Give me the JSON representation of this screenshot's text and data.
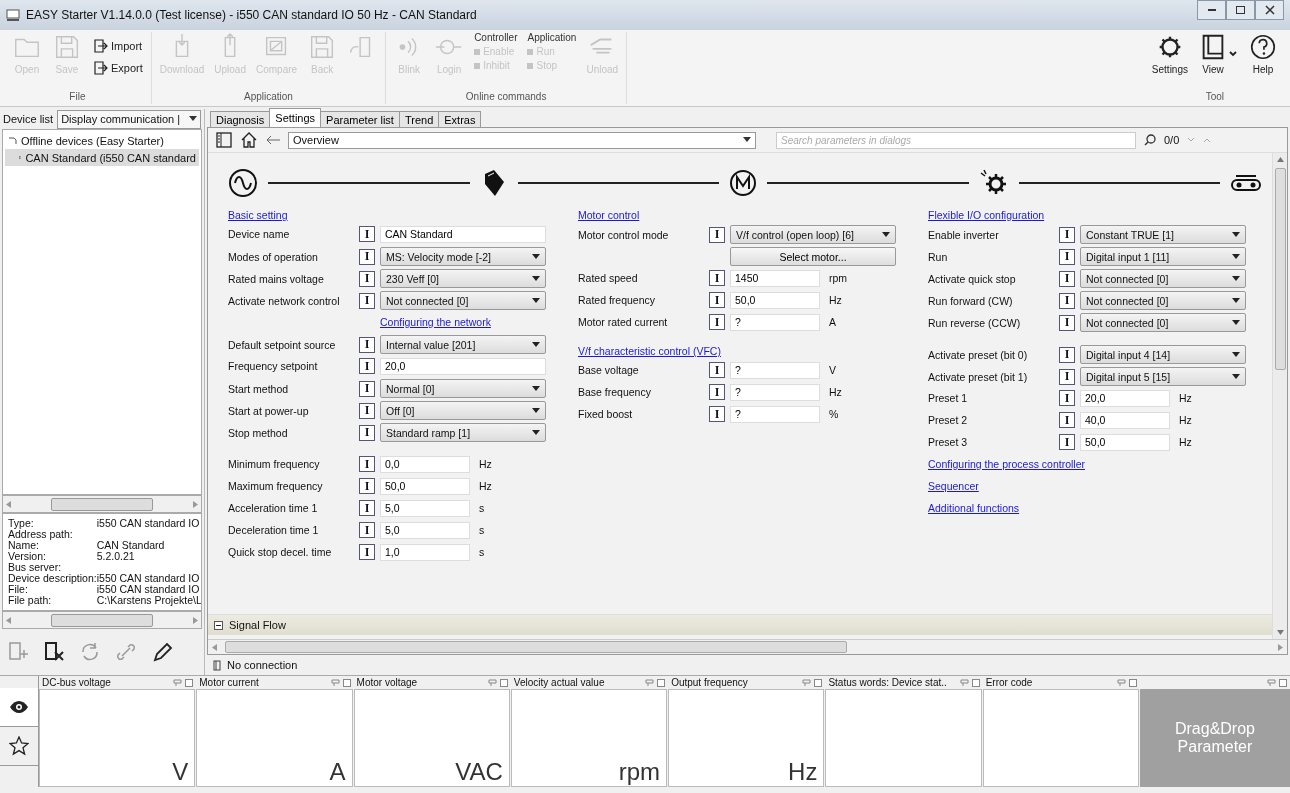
{
  "window": {
    "title": "EASY Starter V1.14.0.0 (Test license) - i550 CAN standard IO 50 Hz - CAN Standard"
  },
  "ribbon": {
    "groups": [
      {
        "label": "File",
        "items": [
          {
            "kind": "large",
            "label": "Open",
            "disabled": true
          },
          {
            "kind": "large",
            "label": "Save",
            "disabled": true
          },
          {
            "kind": "small",
            "label": "Import",
            "disabled": false
          },
          {
            "kind": "small",
            "label": "Export",
            "disabled": false
          }
        ]
      },
      {
        "label": "Application",
        "items": [
          {
            "kind": "large",
            "label": "Download",
            "disabled": true
          },
          {
            "kind": "large",
            "label": "Upload",
            "disabled": true
          },
          {
            "kind": "large",
            "label": "Compare",
            "disabled": true
          },
          {
            "kind": "large",
            "label": "Back",
            "disabled": true
          },
          {
            "kind": "large",
            "disabled": true
          }
        ]
      },
      {
        "label": "Online commands",
        "items": [
          {
            "kind": "large",
            "label": "Blink",
            "disabled": true
          },
          {
            "kind": "large",
            "label": "Login",
            "disabled": true
          },
          {
            "kind": "column",
            "title": "Controller",
            "entries": [
              {
                "label": "Enable",
                "disabled": true
              },
              {
                "label": "Inhibit",
                "disabled": true
              }
            ]
          },
          {
            "kind": "column",
            "title": "Application",
            "entries": [
              {
                "label": "Run",
                "disabled": true
              },
              {
                "label": "Stop",
                "disabled": true
              }
            ]
          },
          {
            "kind": "large",
            "label": "Unload",
            "disabled": true
          }
        ]
      },
      {
        "label": "Tool",
        "items": [
          {
            "kind": "large",
            "label": "Settings",
            "disabled": false
          },
          {
            "kind": "large",
            "label": "View",
            "disabled": false
          },
          {
            "kind": "large",
            "label": "Help",
            "disabled": false
          }
        ]
      }
    ]
  },
  "device_panel": {
    "label": "Device list",
    "dropdown": "Display communication |",
    "tree": [
      {
        "label": "Offline devices (Easy Starter)",
        "expanded": true,
        "selected": false,
        "children": [
          {
            "label": "CAN Standard (i550 CAN standard",
            "selected": true
          }
        ]
      }
    ],
    "properties": [
      {
        "key": "Type:",
        "value": "i550 CAN standard IO"
      },
      {
        "key": "Address path:"
      },
      {
        "key": "Name:",
        "value": "CAN Standard"
      },
      {
        "key": "Version:",
        "value": "5.2.0.21"
      },
      {
        "key": "Bus server:"
      },
      {
        "key": "Device description:",
        "value": "i550 CAN standard IO"
      },
      {
        "key": "File:",
        "value": "i550 CAN standard IO"
      },
      {
        "key": "File path:",
        "value": "C:\\Karstens Projekte\\L"
      }
    ]
  },
  "tabs": [
    {
      "label": "Diagnosis",
      "selected": false
    },
    {
      "label": "Settings",
      "selected": true
    },
    {
      "label": "Parameter list",
      "selected": false
    },
    {
      "label": "Trend",
      "selected": false
    },
    {
      "label": "Extras",
      "selected": false
    }
  ],
  "navigation": {
    "page": "Overview",
    "search": {
      "placeholder": "Search parameters in dialogs"
    },
    "count": "0/0"
  },
  "columns": [
    {
      "blocks": [
        {
          "heading": "Basic setting",
          "rows": [
            {
              "kind": "text",
              "label": "Device name",
              "info": "I",
              "value": "CAN Standard"
            },
            {
              "kind": "select",
              "label": "Modes of operation",
              "info": "I",
              "value": "MS: Velocity mode [-2]"
            },
            {
              "kind": "select",
              "label": "Rated mains voltage",
              "info": "I",
              "value": "230 Veff [0]"
            },
            {
              "kind": "select",
              "label": "Activate network control",
              "info": "I",
              "value": "Not connected [0]"
            },
            {
              "kind": "link",
              "label": "Configuring the network"
            },
            {
              "kind": "select",
              "label": "Default setpoint source",
              "info": "I",
              "value": "Internal value [201]"
            },
            {
              "kind": "text",
              "label": "Frequency setpoint",
              "info": "I",
              "value": "20,0"
            },
            {
              "kind": "select",
              "label": "Start method",
              "info": "I",
              "value": "Normal [0]"
            },
            {
              "kind": "select",
              "label": "Start at power-up",
              "info": "I",
              "value": "Off [0]"
            },
            {
              "kind": "select",
              "label": "Stop method",
              "info": "I",
              "value": "Standard ramp [1]"
            }
          ]
        },
        {
          "rows": [
            {
              "kind": "number",
              "label": "Minimum frequency",
              "info": "I",
              "value": "0,0",
              "unit": "Hz"
            },
            {
              "kind": "number",
              "label": "Maximum frequency",
              "info": "I",
              "value": "50,0",
              "unit": "Hz"
            },
            {
              "kind": "number",
              "label": "Acceleration time 1",
              "info": "I",
              "value": "5,0",
              "unit": "s"
            },
            {
              "kind": "number",
              "label": "Deceleration time 1",
              "info": "I",
              "value": "5,0",
              "unit": "s"
            },
            {
              "kind": "number",
              "label": "Quick stop decel. time",
              "info": "I",
              "value": "1,0",
              "unit": "s"
            }
          ]
        }
      ]
    },
    {
      "blocks": [
        {
          "heading": "Motor control",
          "rows": [
            {
              "kind": "select",
              "label": "Motor control mode",
              "info": "I",
              "value": "V/f control (open loop) [6]"
            },
            {
              "kind": "button",
              "label": "Select motor..."
            },
            {
              "kind": "number",
              "label": "Rated speed",
              "info": "I",
              "value": "1450",
              "unit": "rpm"
            },
            {
              "kind": "number",
              "label": "Rated frequency",
              "info": "I",
              "value": "50,0",
              "unit": "Hz"
            },
            {
              "kind": "number",
              "label": "Motor rated current",
              "info": "I",
              "value": "?",
              "unit": "A"
            }
          ]
        },
        {
          "heading": "V/f characteristic control (VFC)",
          "rows": [
            {
              "kind": "number",
              "label": "Base voltage",
              "info": "I",
              "value": "?",
              "unit": "V"
            },
            {
              "kind": "number",
              "label": "Base frequency",
              "info": "I",
              "value": "?",
              "unit": "Hz"
            },
            {
              "kind": "number",
              "label": "Fixed boost",
              "info": "I",
              "value": "?",
              "unit": "%"
            }
          ]
        }
      ]
    },
    {
      "blocks": [
        {
          "heading": "Flexible I/O configuration",
          "rows": [
            {
              "kind": "select",
              "label": "Enable inverter",
              "info": "I",
              "value": "Constant TRUE [1]"
            },
            {
              "kind": "select",
              "label": "Run",
              "info": "I",
              "value": "Digital input 1 [11]"
            },
            {
              "kind": "select",
              "label": "Activate quick stop",
              "info": "I",
              "value": "Not connected [0]"
            },
            {
              "kind": "select",
              "label": "Run forward (CW)",
              "info": "I",
              "value": "Not connected [0]"
            },
            {
              "kind": "select",
              "label": "Run reverse (CCW)",
              "info": "I",
              "value": "Not connected [0]"
            }
          ]
        },
        {
          "rows": [
            {
              "kind": "select",
              "label": "Activate preset (bit 0)",
              "info": "I",
              "value": "Digital input 4 [14]"
            },
            {
              "kind": "select",
              "label": "Activate preset (bit 1)",
              "info": "I",
              "value": "Digital input 5 [15]"
            },
            {
              "kind": "number",
              "label": "Preset 1",
              "info": "I",
              "value": "20,0",
              "unit": "Hz"
            },
            {
              "kind": "number",
              "label": "Preset 2",
              "info": "I",
              "value": "40,0",
              "unit": "Hz"
            },
            {
              "kind": "number",
              "label": "Preset 3",
              "info": "I",
              "value": "50,0",
              "unit": "Hz"
            },
            {
              "kind": "link",
              "label": "Configuring the process controller"
            },
            {
              "kind": "link",
              "label": "Sequencer"
            },
            {
              "kind": "link",
              "label": "Additional functions"
            }
          ]
        }
      ]
    }
  ],
  "section": {
    "label": "Signal Flow",
    "expanded": true
  },
  "status": "No connection",
  "monitor": {
    "side_tabs": [
      {
        "kind": "eye",
        "selected": true
      },
      {
        "kind": "star",
        "selected": false
      }
    ],
    "channels": [
      {
        "label": "DC-bus voltage",
        "unit": "V"
      },
      {
        "label": "Motor current",
        "unit": "A"
      },
      {
        "label": "Motor voltage",
        "unit": "VAC"
      },
      {
        "label": "Velocity actual value",
        "unit": "rpm"
      },
      {
        "label": "Output frequency",
        "unit": "Hz"
      },
      {
        "label": "Status words: Device stat.."
      },
      {
        "label": "Error code"
      }
    ],
    "drop_target": "Drag&Drop Parameter"
  }
}
